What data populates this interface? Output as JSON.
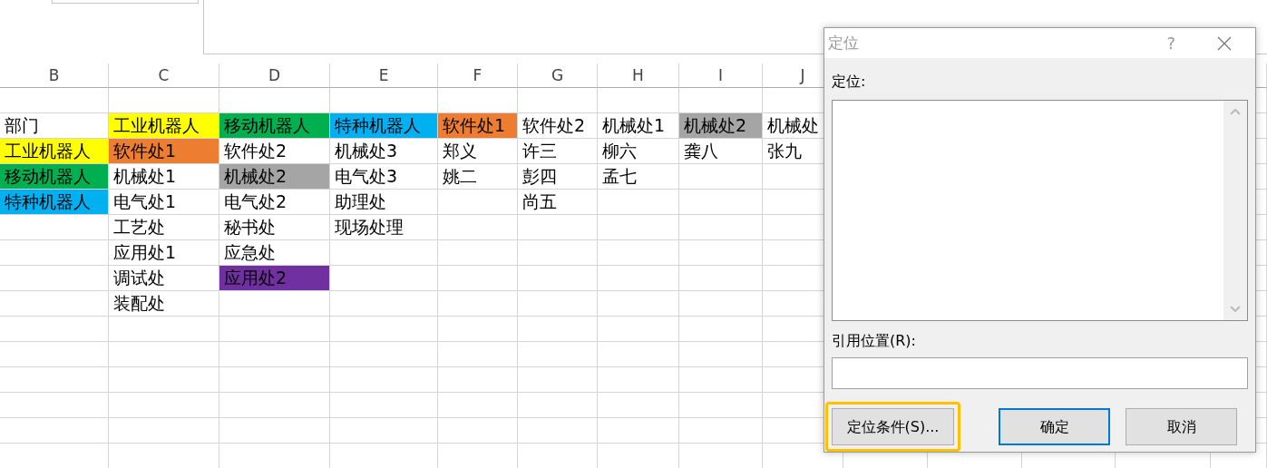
{
  "sheet": {
    "columns": [
      "B",
      "C",
      "D",
      "E",
      "F",
      "G",
      "H",
      "I",
      "J"
    ],
    "rows": [
      {
        "cells": [
          {},
          {},
          {},
          {},
          {},
          {},
          {},
          {},
          {}
        ]
      },
      {
        "cells": [
          {
            "text": "部门"
          },
          {
            "text": "工业机器人",
            "color": "#ffff00"
          },
          {
            "text": "移动机器人",
            "color": "#00b050"
          },
          {
            "text": "特种机器人",
            "color": "#00b0f0"
          },
          {
            "text": "软件处1",
            "color": "#ed7d31"
          },
          {
            "text": "软件处2"
          },
          {
            "text": "机械处1"
          },
          {
            "text": "机械处2",
            "color": "#a5a5a5"
          },
          {
            "text": "机械处"
          }
        ]
      },
      {
        "cells": [
          {
            "text": "工业机器人",
            "color": "#ffff00"
          },
          {
            "text": "软件处1",
            "color": "#ed7d31"
          },
          {
            "text": "软件处2"
          },
          {
            "text": "机械处3"
          },
          {
            "text": "郑义"
          },
          {
            "text": "许三"
          },
          {
            "text": "柳六"
          },
          {
            "text": "龚八"
          },
          {
            "text": "张九"
          }
        ]
      },
      {
        "cells": [
          {
            "text": "移动机器人",
            "color": "#00b050"
          },
          {
            "text": "机械处1"
          },
          {
            "text": "机械处2",
            "color": "#a5a5a5"
          },
          {
            "text": "电气处3"
          },
          {
            "text": "姚二"
          },
          {
            "text": "彭四"
          },
          {
            "text": "孟七"
          },
          {},
          {}
        ]
      },
      {
        "cells": [
          {
            "text": "特种机器人",
            "color": "#00b0f0"
          },
          {
            "text": "电气处1"
          },
          {
            "text": "电气处2"
          },
          {
            "text": "助理处"
          },
          {},
          {
            "text": "尚五"
          },
          {},
          {},
          {}
        ]
      },
      {
        "cells": [
          {},
          {
            "text": "工艺处"
          },
          {
            "text": "秘书处"
          },
          {
            "text": "现场处理"
          },
          {},
          {},
          {},
          {},
          {}
        ]
      },
      {
        "cells": [
          {},
          {
            "text": "应用处1"
          },
          {
            "text": "应急处"
          },
          {},
          {},
          {},
          {},
          {},
          {}
        ]
      },
      {
        "cells": [
          {},
          {
            "text": "调试处"
          },
          {
            "text": "应用处2",
            "color": "#7030a0"
          },
          {},
          {},
          {},
          {},
          {},
          {}
        ]
      },
      {
        "cells": [
          {},
          {
            "text": "装配处"
          },
          {},
          {},
          {},
          {},
          {},
          {},
          {}
        ]
      },
      {
        "cells": [
          {},
          {},
          {},
          {},
          {},
          {},
          {},
          {},
          {}
        ]
      },
      {
        "cells": [
          {},
          {},
          {},
          {},
          {},
          {},
          {},
          {},
          {}
        ]
      },
      {
        "cells": [
          {},
          {},
          {},
          {},
          {},
          {},
          {},
          {},
          {}
        ]
      },
      {
        "cells": [
          {},
          {},
          {},
          {},
          {},
          {},
          {},
          {},
          {}
        ]
      },
      {
        "cells": [
          {},
          {},
          {},
          {},
          {},
          {},
          {},
          {},
          {}
        ]
      },
      {
        "cells": [
          {},
          {},
          {},
          {},
          {},
          {},
          {},
          {},
          {}
        ]
      }
    ]
  },
  "dialog": {
    "title": "定位",
    "help": "?",
    "list_label": "定位:",
    "reference_label": "引用位置(R):",
    "buttons": [
      {
        "label": "定位条件(S)...",
        "default": false,
        "highlighted": true
      },
      {
        "label": "确定",
        "default": true,
        "highlighted": false
      },
      {
        "label": "取消",
        "default": false,
        "highlighted": false
      }
    ]
  }
}
